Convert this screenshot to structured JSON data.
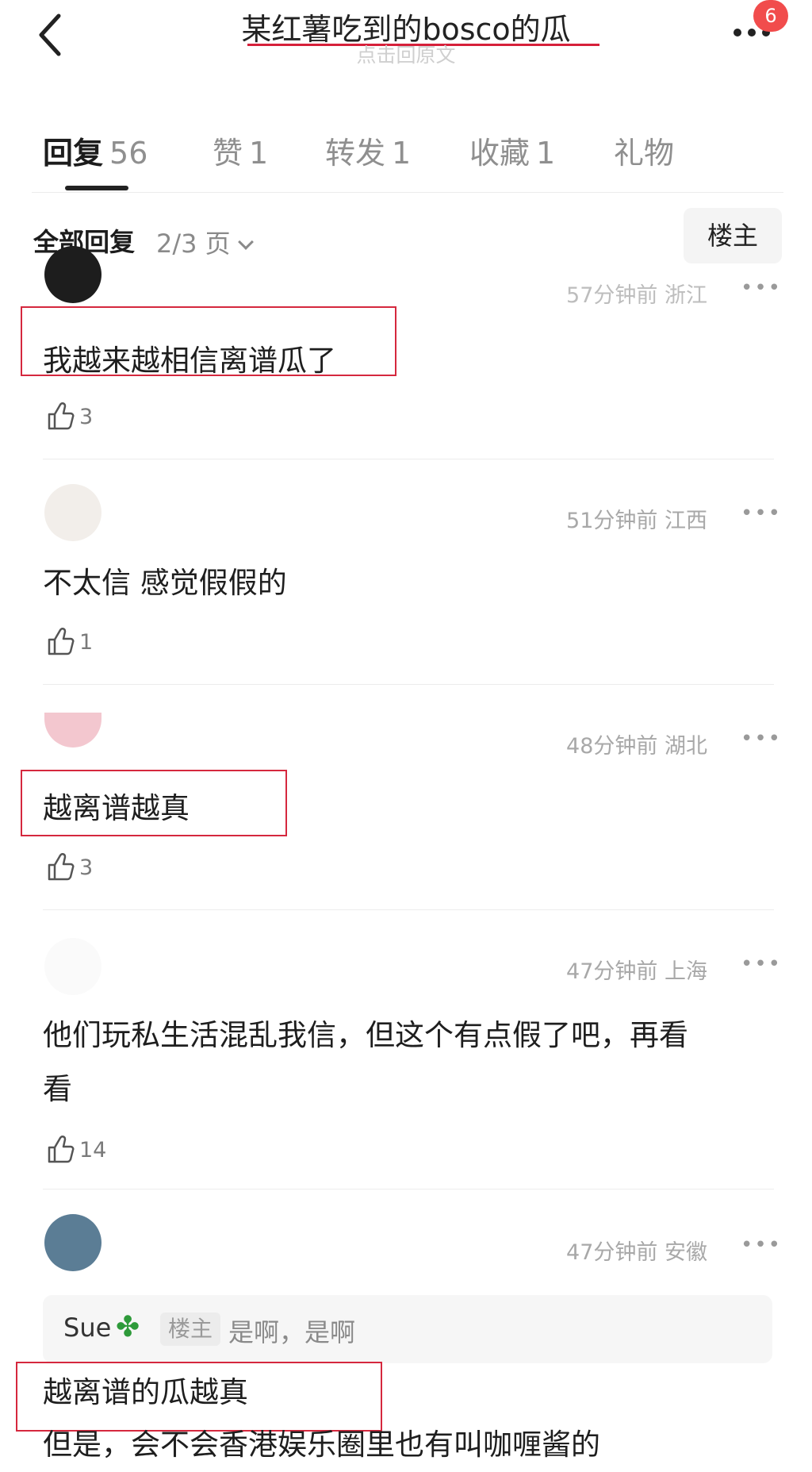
{
  "header": {
    "title": "某红薯吃到的bosco的瓜",
    "subtitle": "点击回原文",
    "notification_count": "6"
  },
  "tabs": [
    {
      "label": "回复",
      "count": "56"
    },
    {
      "label": "赞",
      "count": "1"
    },
    {
      "label": "转发",
      "count": "1"
    },
    {
      "label": "收藏",
      "count": "1"
    },
    {
      "label": "礼物",
      "count": ""
    }
  ],
  "filter": {
    "label": "全部回复",
    "page": "2/3 页",
    "op_button": "楼主"
  },
  "comments": [
    {
      "meta": "57分钟前 浙江",
      "text": "我越来越相信离谱瓜了",
      "likes": "3"
    },
    {
      "meta": "51分钟前 江西",
      "text": "不太信  感觉假假的",
      "likes": "1"
    },
    {
      "meta": "48分钟前 湖北",
      "text": "越离谱越真",
      "likes": "3"
    },
    {
      "meta": "47分钟前 上海",
      "text": "他们玩私生活混乱我信，但这个有点假了吧，再看",
      "text2": "看",
      "likes": "14"
    },
    {
      "meta": "47分钟前 安徽",
      "reply_name": "Sue",
      "reply_tag": "楼主",
      "reply_text": "是啊，是啊",
      "text": "越离谱的瓜越真",
      "text2": "但是，会不会香港娱乐圈里也有叫咖喱酱的"
    }
  ]
}
